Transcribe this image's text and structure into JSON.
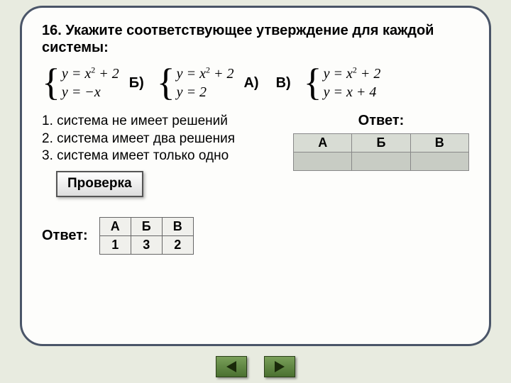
{
  "question": "16. Укажите соответствующее утверждение для каждой системы:",
  "labels": {
    "b": "Б)",
    "a": "А)",
    "v": "В)"
  },
  "systems": {
    "s1": {
      "eq1": "y = x² + 2",
      "eq2": "y = −x"
    },
    "s2": {
      "eq1": "y = x² + 2",
      "eq2": "y = 2"
    },
    "s3": {
      "eq1": "y = x² + 2",
      "eq2": "y = x + 4"
    }
  },
  "statements": {
    "s1": "1. система не имеет решений",
    "s2": "2. система имеет два решения",
    "s3": "3. система имеет только одно"
  },
  "answer_title": "Ответ:",
  "cols": {
    "a": "А",
    "b": "Б",
    "v": "В"
  },
  "check_label": "Проверка",
  "bottom_answer_label": "Ответ:",
  "solution": {
    "a": "1",
    "b": "3",
    "v": "2"
  }
}
